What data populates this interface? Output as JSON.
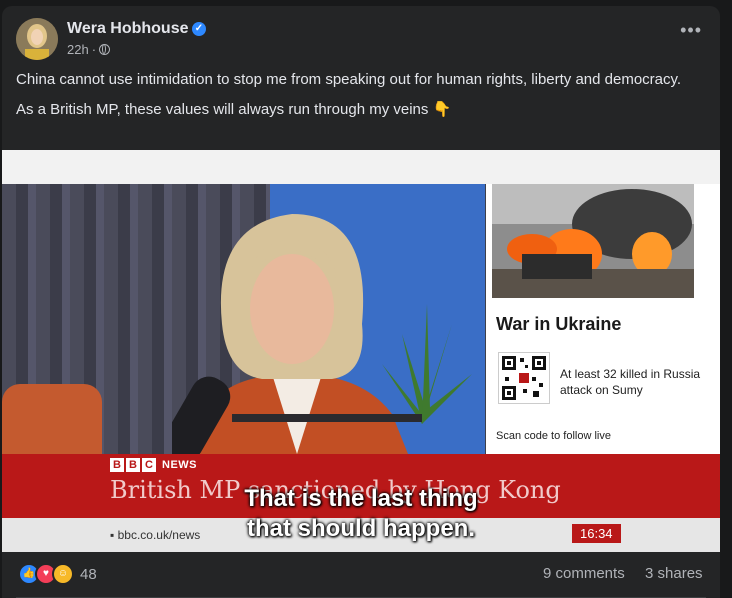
{
  "post": {
    "author": "Wera Hobhouse",
    "time": "22h",
    "separator": "·",
    "more_label": "•••",
    "text_lines": [
      "China cannot use intimidation to stop me from speaking out for human rights, liberty and democracy.",
      "As a British MP, these values will always run through my veins 👇"
    ]
  },
  "video": {
    "sidebar_title": "War in Ukraine",
    "sidebar_news": "At least 32 killed in Russia attack on Sumy",
    "scan_text": "Scan code to follow live",
    "brand_letters": [
      "B",
      "B",
      "C"
    ],
    "brand_label": "NEWS",
    "headline": "British MP sanctioned by Hong Kong",
    "url": "bbc.co.uk/news",
    "clock": "16:34",
    "subtitle_line1": "That is the last thing",
    "subtitle_line2": "that should happen."
  },
  "footer": {
    "reaction_count": "48",
    "comments": "9 comments",
    "shares": "3 shares"
  },
  "colors": {
    "background": "#18191a",
    "card": "#242526",
    "bbc_red": "#b91818",
    "verified_blue": "#2d88ff"
  }
}
